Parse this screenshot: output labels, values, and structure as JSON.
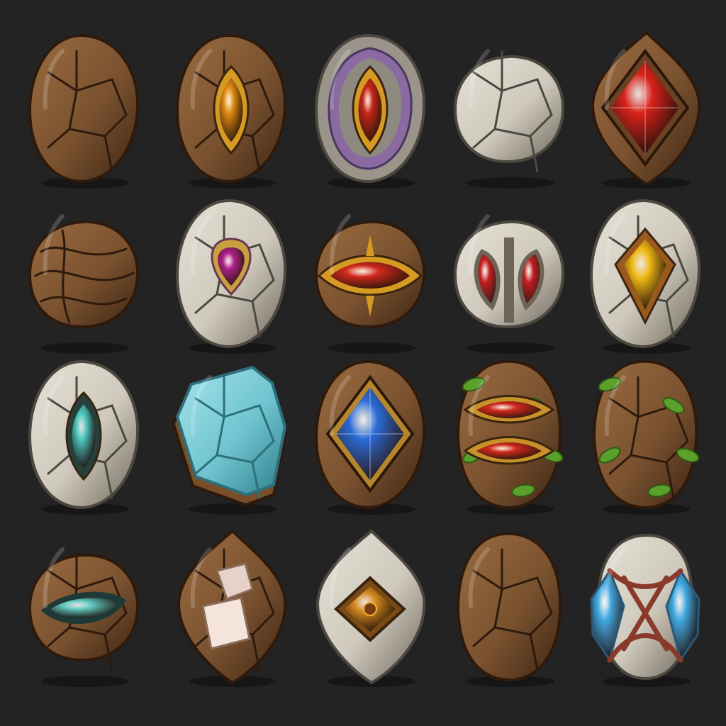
{
  "sheet": {
    "background": "#232323",
    "columns": 5,
    "rows": 4
  },
  "palette": {
    "wood": "#7a5230",
    "wood_dark": "#3e2614",
    "stone": "#cfc9bd",
    "stone_dark": "#5f5a52",
    "gold": "#d49a22",
    "purple_rim": "#8a6aa0"
  },
  "icons": [
    {
      "name": "wood-rock-plain-icon",
      "material": "wood",
      "shape": "egg",
      "cracks": true,
      "gem": null
    },
    {
      "name": "wood-rock-amber-eye-icon",
      "material": "wood",
      "shape": "egg",
      "cracks": true,
      "gem": {
        "shape": "eye-vertical",
        "color": "#e08a10",
        "rim": "#d49a22"
      }
    },
    {
      "name": "stone-purple-rim-red-gem-icon",
      "material": "stone",
      "shape": "egg",
      "cracks": false,
      "purple_rim": true,
      "gem": {
        "shape": "eye-vertical",
        "color": "#c82618",
        "rim": "#d49a22"
      }
    },
    {
      "name": "stone-cobble-icon",
      "material": "stone",
      "shape": "round",
      "cracks": true,
      "gem": null
    },
    {
      "name": "wood-framed-red-crystal-icon",
      "material": "wood",
      "shape": "diamond",
      "cracks": false,
      "gem": {
        "shape": "diamond-large",
        "color": "#d8221a",
        "rim": "#6a4222"
      }
    },
    {
      "name": "wood-swirl-rock-icon",
      "material": "wood",
      "shape": "round",
      "cracks": true,
      "swirl": true,
      "gem": null
    },
    {
      "name": "stone-magenta-gem-icon",
      "material": "stone",
      "shape": "egg",
      "cracks": true,
      "gem": {
        "shape": "heart",
        "color": "#b0208a",
        "rim": "#c9a040"
      }
    },
    {
      "name": "wood-red-eye-gem-icon",
      "material": "wood",
      "shape": "round",
      "cracks": false,
      "gem": {
        "shape": "eye-horizontal",
        "color": "#d0281c",
        "rim": "#d49a22"
      }
    },
    {
      "name": "stone-twin-red-gems-icon",
      "material": "stone",
      "shape": "round",
      "cracks": false,
      "gem": {
        "shape": "twin",
        "color": "#c21e20",
        "rim": "#6d6456"
      }
    },
    {
      "name": "stone-yellow-gem-icon",
      "material": "stone",
      "shape": "egg",
      "cracks": true,
      "gem": {
        "shape": "kite",
        "color": "#f0b814",
        "rim": "#9a5a1e"
      }
    },
    {
      "name": "stone-teal-eye-icon",
      "material": "stone",
      "shape": "egg",
      "cracks": true,
      "gem": {
        "shape": "eye-vertical",
        "color": "#4fc8c0",
        "rim": "#26403c"
      }
    },
    {
      "name": "wood-framed-ice-slab-icon",
      "material": "ice",
      "shape": "slab",
      "cracks": true,
      "gem": null
    },
    {
      "name": "wood-blue-diamond-gem-icon",
      "material": "wood",
      "shape": "egg",
      "cracks": false,
      "gem": {
        "shape": "diamond-large",
        "color": "#2a6ad8",
        "rim": "#b8862a"
      }
    },
    {
      "name": "wood-twin-red-eyes-icon",
      "material": "wood",
      "shape": "tall",
      "cracks": false,
      "leaves": true,
      "gem": {
        "shape": "double-eye",
        "color": "#d2281c",
        "rim": "#c8922a"
      }
    },
    {
      "name": "wood-leafy-trunk-icon",
      "material": "wood",
      "shape": "tall",
      "cracks": true,
      "leaves": true,
      "gem": null
    },
    {
      "name": "wood-teal-slot-rock-icon",
      "material": "wood",
      "shape": "round",
      "cracks": true,
      "gem": {
        "shape": "slot",
        "color": "#63c9bf",
        "rim": "#1f3a36"
      }
    },
    {
      "name": "wood-pink-crystal-icon",
      "material": "wood",
      "shape": "diamond",
      "cracks": true,
      "gem": {
        "shape": "crystals",
        "color": "#e6d2c8",
        "rim": "#8a6a58"
      }
    },
    {
      "name": "stone-gold-diamond-icon",
      "material": "stone",
      "shape": "diamond",
      "cracks": false,
      "gem": {
        "shape": "diamond-small",
        "color": "#d48a1e",
        "rim": "#7a4a14"
      }
    },
    {
      "name": "wood-boulder-icon",
      "material": "wood",
      "shape": "tall",
      "cracks": true,
      "gem": null
    },
    {
      "name": "stone-blue-crystal-bound-icon",
      "material": "stone",
      "shape": "capsule",
      "cracks": false,
      "vines": true,
      "gem": {
        "shape": "side-crystals",
        "color": "#3fa8e0",
        "rim": "#8a3a2a"
      }
    }
  ]
}
